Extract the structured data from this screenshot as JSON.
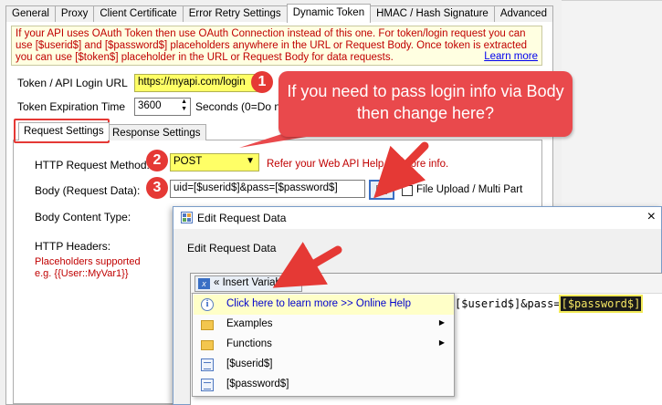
{
  "tabs": [
    "General",
    "Proxy",
    "Client Certificate",
    "Error Retry Settings",
    "Dynamic Token",
    "HMAC / Hash Signature",
    "Advanced"
  ],
  "active_tab": "Dynamic Token",
  "info": {
    "text": "If your API uses OAuth Token then use OAuth Connection instead of this one. For token/login request you can use [$userid$] and [$password$] placeholders anywhere in the URL or Request Body. Once token is extracted you can use [$token$] placeholder in the URL or Request Body for data requests.",
    "learn_more": "Learn more"
  },
  "login_url": {
    "label": "Token / API Login URL",
    "value": "https://myapi.com/login"
  },
  "expiration": {
    "label": "Token Expiration Time",
    "value": "3600",
    "suffix": "Seconds (0=Do no"
  },
  "inner_tabs": [
    "Request Settings",
    "Response Settings"
  ],
  "request": {
    "method_label": "HTTP Request Method:",
    "method_value": "POST",
    "method_hint": "Refer your Web API Help for more info.",
    "body_label": "Body (Request Data):",
    "body_value": "uid=[$userid$]&pass=[$password$]",
    "file_upload": "File Upload / Multi Part",
    "content_type_label": "Body Content Type:",
    "headers_label": "HTTP Headers:",
    "placeholders_note": "Placeholders supported",
    "placeholders_example": "e.g. {{User::MyVar1}}"
  },
  "callout": {
    "text": "If you need to pass login info via Body then change here?"
  },
  "badges": [
    "1",
    "2",
    "3"
  ],
  "dialog": {
    "title": "Edit Request Data",
    "close": "×",
    "subhead": "Edit Request Data",
    "insert_variable": "« Insert Variable »",
    "code_prefix": "[$userid$]&pass=",
    "code_highlight": "[$password$]"
  },
  "menu": [
    {
      "label": "Click here to learn more >> Online Help",
      "icon": "info-icon",
      "submenu": false
    },
    {
      "label": "Examples",
      "icon": "folder-icon",
      "submenu": true
    },
    {
      "label": "Functions",
      "icon": "folder-icon",
      "submenu": true
    },
    {
      "label": "[$userid$]",
      "icon": "variable-icon",
      "submenu": false
    },
    {
      "label": "[$password$]",
      "icon": "variable-icon",
      "submenu": false
    }
  ]
}
